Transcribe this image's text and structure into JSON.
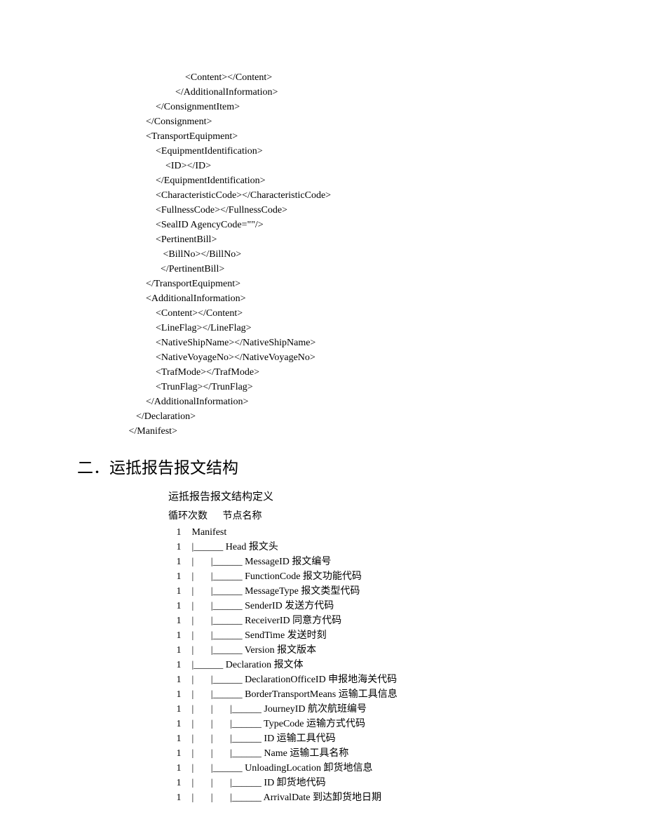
{
  "xml_lines": [
    "                        <Content></Content>",
    "                    </AdditionalInformation>",
    "            </ConsignmentItem>",
    "        </Consignment>",
    "        <TransportEquipment>",
    "            <EquipmentIdentification>",
    "                <ID></ID>",
    "            </EquipmentIdentification>",
    "            <CharacteristicCode></CharacteristicCode>",
    "            <FullnessCode></FullnessCode>",
    "            <SealID AgencyCode=\"\"/>",
    "            <PertinentBill>",
    "               <BillNo></BillNo>",
    "              </PertinentBill>",
    "        </TransportEquipment>",
    "        <AdditionalInformation>",
    "            <Content></Content>",
    "            <LineFlag></LineFlag>",
    "            <NativeShipName></NativeShipName>",
    "            <NativeVoyageNo></NativeVoyageNo>",
    "            <TrafMode></TrafMode>",
    "            <TrunFlag></TrunFlag>",
    "        </AdditionalInformation>",
    "    </Declaration>",
    " </Manifest>"
  ],
  "heading": "二．运抵报告报文结构",
  "subheading": "运抵报告报文结构定义",
  "tree_header": {
    "col1": "循环次数",
    "col2": "节点名称"
  },
  "tree": [
    {
      "count": "1",
      "node": " Manifest"
    },
    {
      "count": "1",
      "node": " |______ Head 报文头"
    },
    {
      "count": "1",
      "node": " |       |______ MessageID 报文编号"
    },
    {
      "count": "1",
      "node": " |       |______ FunctionCode 报文功能代码"
    },
    {
      "count": "1",
      "node": " |       |______ MessageType 报文类型代码"
    },
    {
      "count": "1",
      "node": " |       |______ SenderID 发送方代码"
    },
    {
      "count": "1",
      "node": " |       |______ ReceiverID 同意方代码"
    },
    {
      "count": "1",
      "node": " |       |______ SendTime 发送时刻"
    },
    {
      "count": "1",
      "node": " |       |______ Version 报文版本"
    },
    {
      "count": "1",
      "node": " |______ Declaration 报文体"
    },
    {
      "count": "1",
      "node": " |       |______ DeclarationOfficeID 申报地海关代码"
    },
    {
      "count": "1",
      "node": " |       |______ BorderTransportMeans 运输工具信息"
    },
    {
      "count": "1",
      "node": " |       |       |______ JourneyID 航次航班编号"
    },
    {
      "count": "1",
      "node": " |       |       |______ TypeCode 运输方式代码"
    },
    {
      "count": "1",
      "node": " |       |       |______ ID 运输工具代码"
    },
    {
      "count": "1",
      "node": " |       |       |______ Name 运输工具名称"
    },
    {
      "count": "1",
      "node": " |       |______ UnloadingLocation 卸货地信息"
    },
    {
      "count": "1",
      "node": " |       |       |______ ID 卸货地代码"
    },
    {
      "count": "1",
      "node": " |       |       |______ ArrivalDate 到达卸货地日期"
    }
  ]
}
